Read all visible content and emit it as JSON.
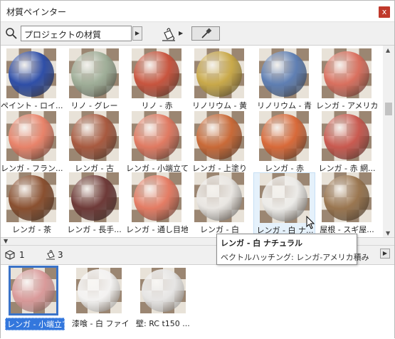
{
  "window": {
    "title": "材質ペインター",
    "close_glyph": "x"
  },
  "toolbar": {
    "search_value": "プロジェクトの材質"
  },
  "materials": [
    {
      "label": "ペイント - ロイ...",
      "color": "#2f4fa8"
    },
    {
      "label": "リノ - グレー",
      "color": "#9fae98"
    },
    {
      "label": "リノ - 赤",
      "color": "#c8553f"
    },
    {
      "label": "リノリウム - 黄",
      "color": "#c9a94a"
    },
    {
      "label": "リノリウム - 青",
      "color": "#5f7fb3"
    },
    {
      "label": "レンガ - アメリカ...",
      "color": "#d9705f"
    },
    {
      "label": "レンガ - フラン...",
      "color": "#e8836a"
    },
    {
      "label": "レンガ - 古",
      "color": "#a85a40"
    },
    {
      "label": "レンガ - 小端立て",
      "color": "#e07a62"
    },
    {
      "label": "レンガ - 上塗り",
      "color": "#c96a38"
    },
    {
      "label": "レンガ - 赤",
      "color": "#d86a3a"
    },
    {
      "label": "レンガ - 赤 網...",
      "color": "#c95a50"
    },
    {
      "label": "レンガ - 茶",
      "color": "#8a5030"
    },
    {
      "label": "レンガ - 長手...",
      "color": "#6e3a38"
    },
    {
      "label": "レンガ - 通し目地",
      "color": "#e47c64"
    },
    {
      "label": "レンガ - 白",
      "color": "#e9e6e2"
    },
    {
      "label": "レンガ - 白 ナ...",
      "color": "#ecebe8"
    },
    {
      "label": "屋根 - スギ屋...",
      "color": "#9a7650"
    }
  ],
  "status": {
    "count_objects": "1",
    "count_materials": "3"
  },
  "used_materials": [
    {
      "label": "レンガ - 小端立て",
      "color": "#d99a9a",
      "selected": true
    },
    {
      "label": "漆喰 - 白 ファイン",
      "color": "#f3f2f1",
      "selected": false
    },
    {
      "label": "壁: RC t150 ...",
      "color": "#e6e5e4",
      "selected": false
    }
  ],
  "tooltip": {
    "title": "レンガ - 白 ナチュラル",
    "detail": "ベクトルハッチング: レンガ-アメリカ積み"
  }
}
